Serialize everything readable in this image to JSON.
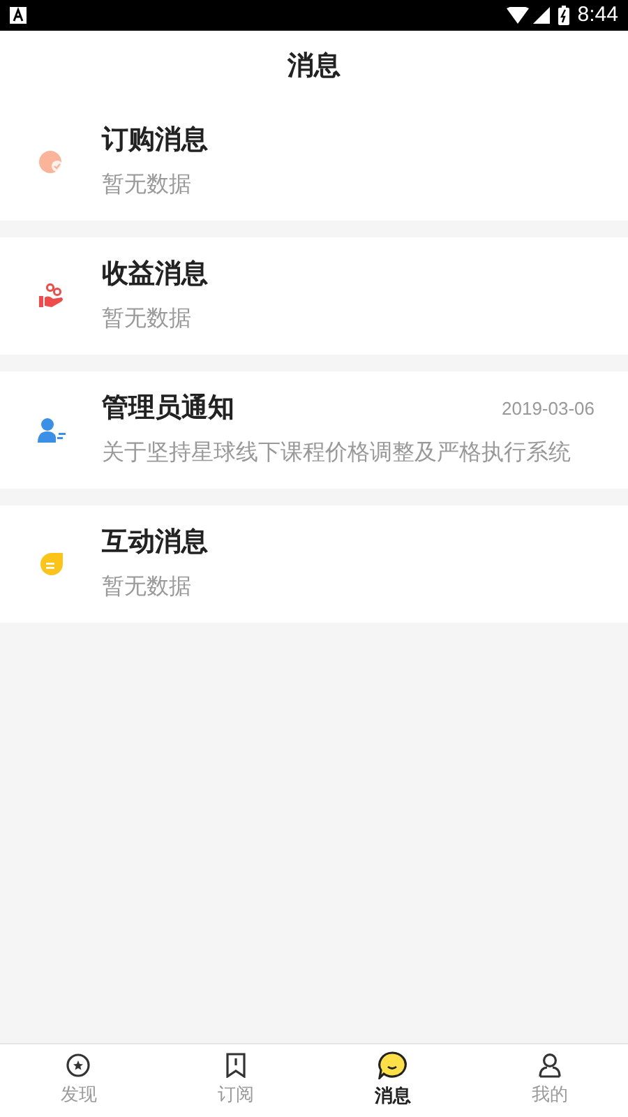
{
  "status_bar": {
    "time": "8:44"
  },
  "header": {
    "title": "消息"
  },
  "messages": [
    {
      "kind": "order",
      "title": "订购消息",
      "preview": "暂无数据"
    },
    {
      "kind": "income",
      "title": "收益消息",
      "preview": "暂无数据"
    },
    {
      "kind": "admin",
      "title": "管理员通知",
      "date": "2019-03-06",
      "preview": "关于坚持星球线下课程价格调整及严格执行系统"
    },
    {
      "kind": "interaction",
      "title": "互动消息",
      "preview": "暂无数据"
    }
  ],
  "tabs": [
    {
      "kind": "discover",
      "label": "发现",
      "selected": false
    },
    {
      "kind": "subscribe",
      "label": "订阅",
      "selected": false
    },
    {
      "kind": "messages",
      "label": "消息",
      "selected": true
    },
    {
      "kind": "me",
      "label": "我的",
      "selected": false
    }
  ]
}
